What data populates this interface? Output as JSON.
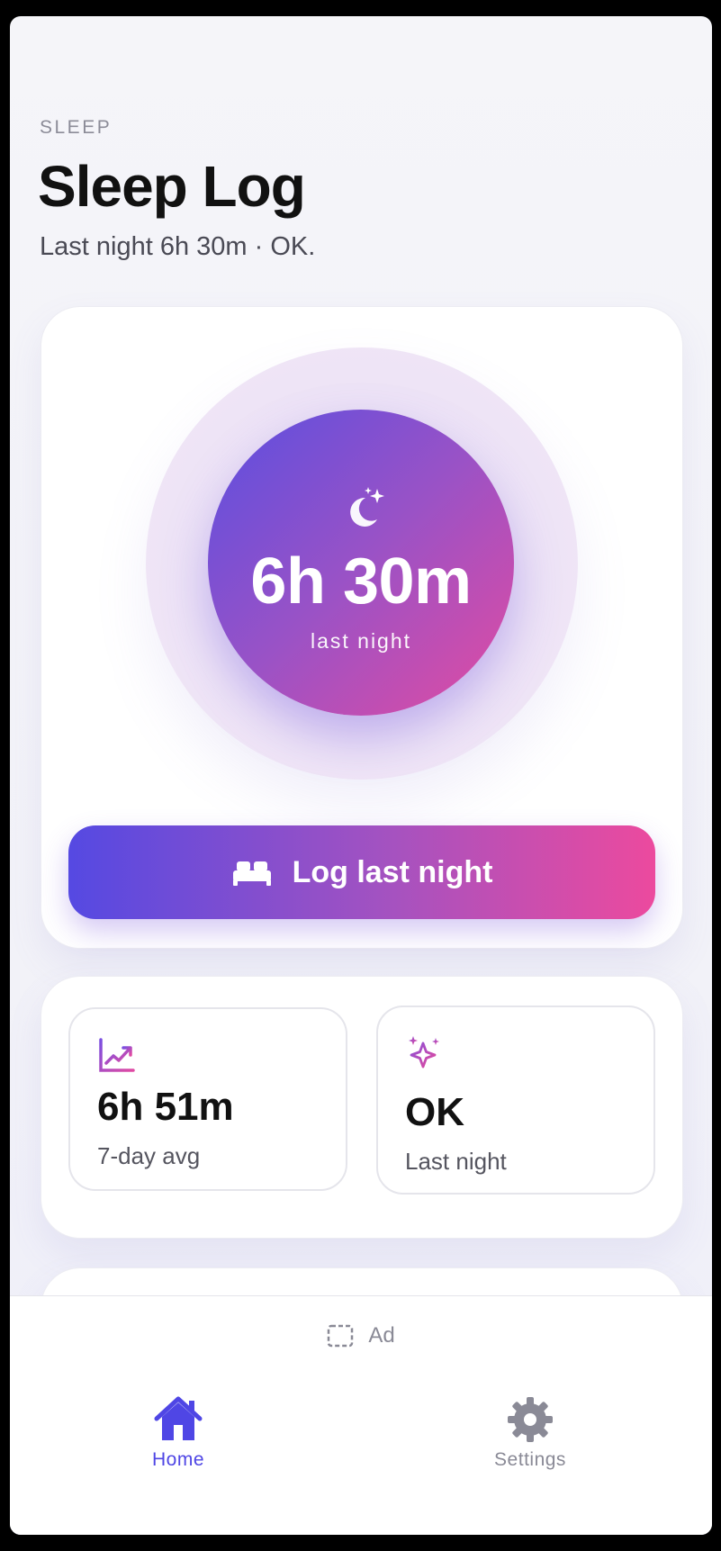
{
  "header": {
    "eyebrow": "SLEEP",
    "title": "Sleep Log",
    "subtitle": "Last night 6h 30m · OK."
  },
  "hero": {
    "icon": "moon-stars-icon",
    "value": "6h 30m",
    "caption": "last night",
    "button_label": "Log last night",
    "button_icon": "bed-icon",
    "gradient_start": "#5549e2",
    "gradient_end": "#ec4a9e"
  },
  "stats": [
    {
      "icon": "trend-chart-icon",
      "value": "6h 51m",
      "label": "7-day avg"
    },
    {
      "icon": "sparkles-icon",
      "value": "OK",
      "label": "Last night"
    }
  ],
  "ad": {
    "label": "Ad",
    "icon": "ad-placeholder-icon"
  },
  "tabbar": {
    "active_color": "#4f46e5",
    "items": [
      {
        "label": "Home",
        "icon": "house-icon",
        "active": true
      },
      {
        "label": "Settings",
        "icon": "gear-icon",
        "active": false
      }
    ]
  }
}
